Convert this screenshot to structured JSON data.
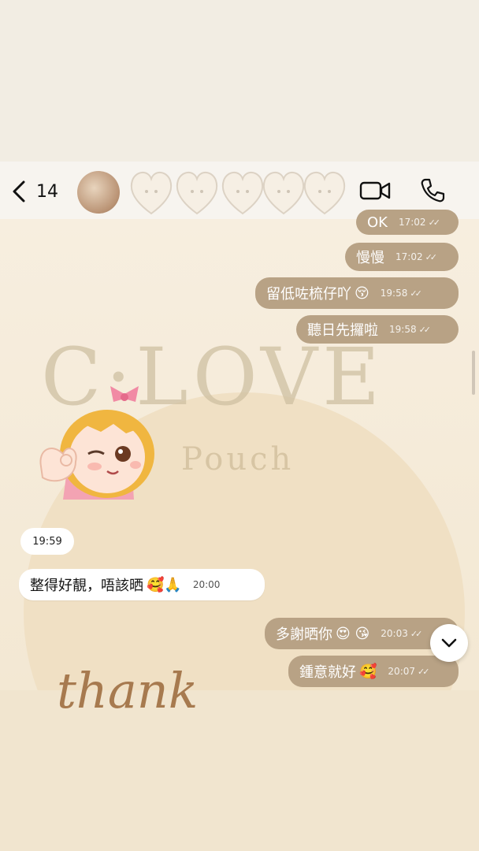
{
  "header": {
    "back_count": "14",
    "icons": [
      "chevron-left-icon",
      "avatar",
      "video-camera-icon",
      "phone-icon"
    ]
  },
  "messages": [
    {
      "text": "OK",
      "time": "17:02",
      "direction": "outgoing",
      "read": true
    },
    {
      "text": "慢慢",
      "time": "17:02",
      "direction": "outgoing",
      "read": true
    },
    {
      "text": "留低咗梳仔吖",
      "emoji": "😚",
      "time": "19:58",
      "direction": "outgoing",
      "read": true
    },
    {
      "text": "聽日先攞啦",
      "time": "19:58",
      "direction": "outgoing",
      "read": true
    },
    {
      "text": "整得好靚，唔該晒",
      "emoji": "🥰🙏",
      "time": "20:00",
      "direction": "incoming"
    },
    {
      "text": "多謝晒你",
      "emoji": "😍 😘",
      "time": "20:03",
      "direction": "outgoing",
      "read": true
    },
    {
      "text": "鍾意就好",
      "emoji": "🥰",
      "time": "20:07",
      "direction": "outgoing",
      "read": true
    }
  ],
  "timestamp_badge": "19:59",
  "tick_glyph": "✓✓",
  "decor": {
    "watermark": "C·LOVE",
    "watermark_sub": "Pouch",
    "handwriting": "thank"
  },
  "colors": {
    "outgoing_bubble": "#b8a285",
    "incoming_bubble": "#ffffff",
    "background": "#f3e8d3"
  }
}
